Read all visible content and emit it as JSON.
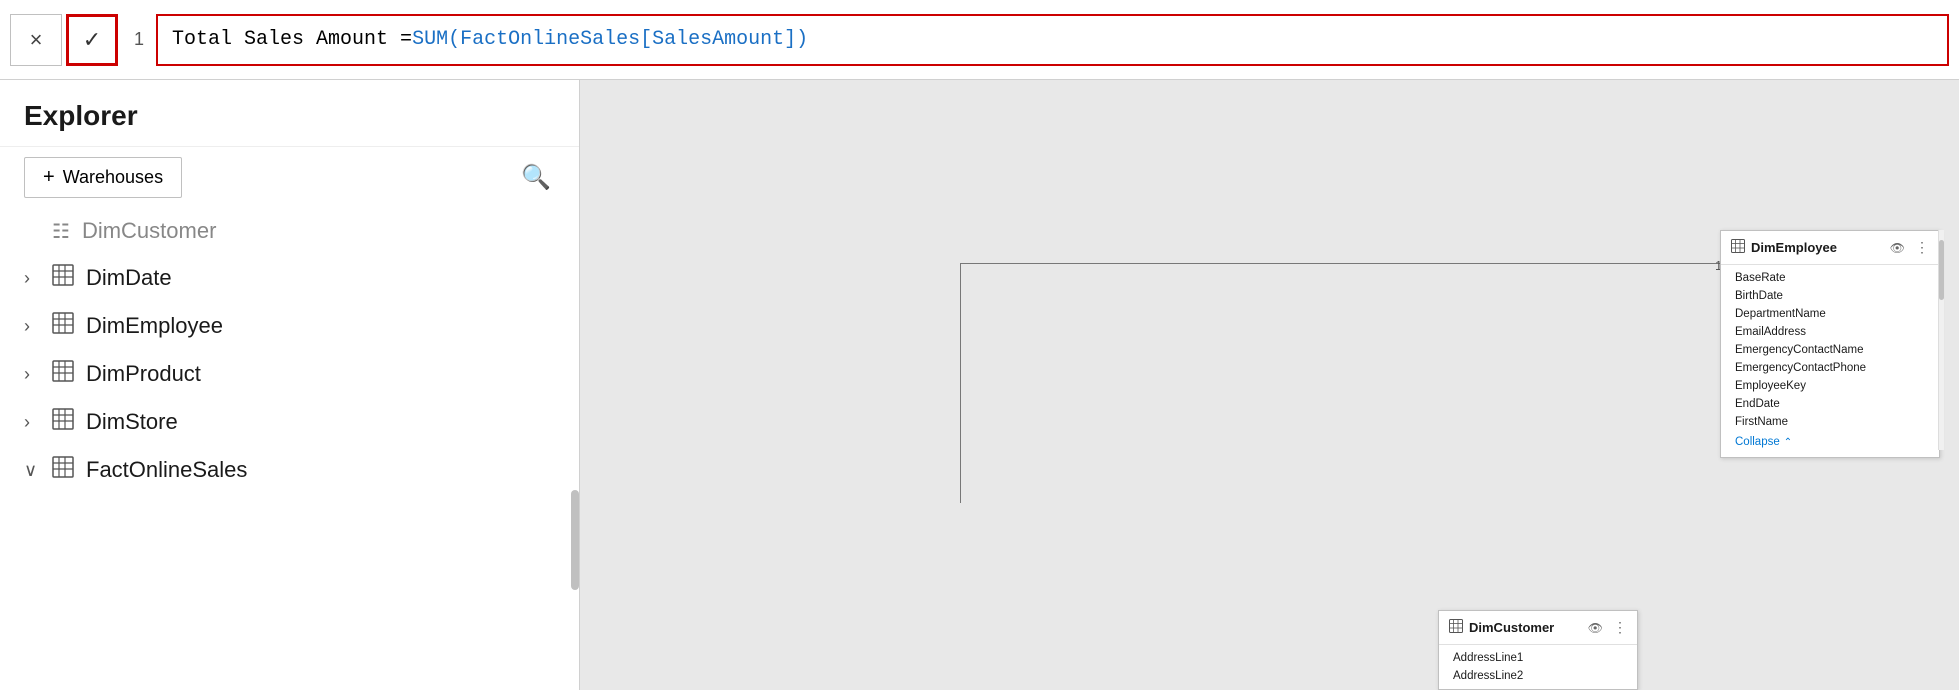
{
  "formula_bar": {
    "cancel_label": "×",
    "confirm_label": "✓",
    "line_number": "1",
    "formula_text": "Total Sales Amount = SUM(FactOnlineSales[SalesAmount])",
    "formula_parts": {
      "plain": "Total Sales Amount = ",
      "colored": "SUM(FactOnlineSales[SalesAmount])"
    }
  },
  "sidebar": {
    "title": "Explorer",
    "add_button_label": "Warehouses",
    "plus_symbol": "+",
    "search_symbol": "⌕",
    "tree_items": [
      {
        "id": "dimcustomer-partial",
        "label": "DimCustomer",
        "chevron": "",
        "collapsed": true,
        "partial": true
      },
      {
        "id": "dimdate",
        "label": "DimDate",
        "chevron": "›",
        "collapsed": true
      },
      {
        "id": "dimemployee",
        "label": "DimEmployee",
        "chevron": "›",
        "collapsed": true
      },
      {
        "id": "dimproduct",
        "label": "DimProduct",
        "chevron": "›",
        "collapsed": true
      },
      {
        "id": "dimstore",
        "label": "DimStore",
        "chevron": "›",
        "collapsed": true
      },
      {
        "id": "factonlinesales",
        "label": "FactOnlineSales",
        "chevron": "∨",
        "collapsed": false
      }
    ]
  },
  "canvas": {
    "dim_employee_card": {
      "title": "DimEmployee",
      "fields": [
        "BaseRate",
        "BirthDate",
        "DepartmentName",
        "EmailAddress",
        "EmergencyContactName",
        "EmergencyContactPhone",
        "EmployeeKey",
        "EndDate",
        "FirstName"
      ],
      "collapse_label": "Collapse"
    },
    "dim_customer_card": {
      "title": "DimCustomer",
      "fields": [
        "AddressLine1",
        "AddressLine2"
      ]
    },
    "line_number": "1"
  },
  "colors": {
    "accent_blue": "#0078d4",
    "formula_red": "#cc0000",
    "formula_colored_text": "#1a6fc4",
    "canvas_bg": "#e8e8e8"
  }
}
